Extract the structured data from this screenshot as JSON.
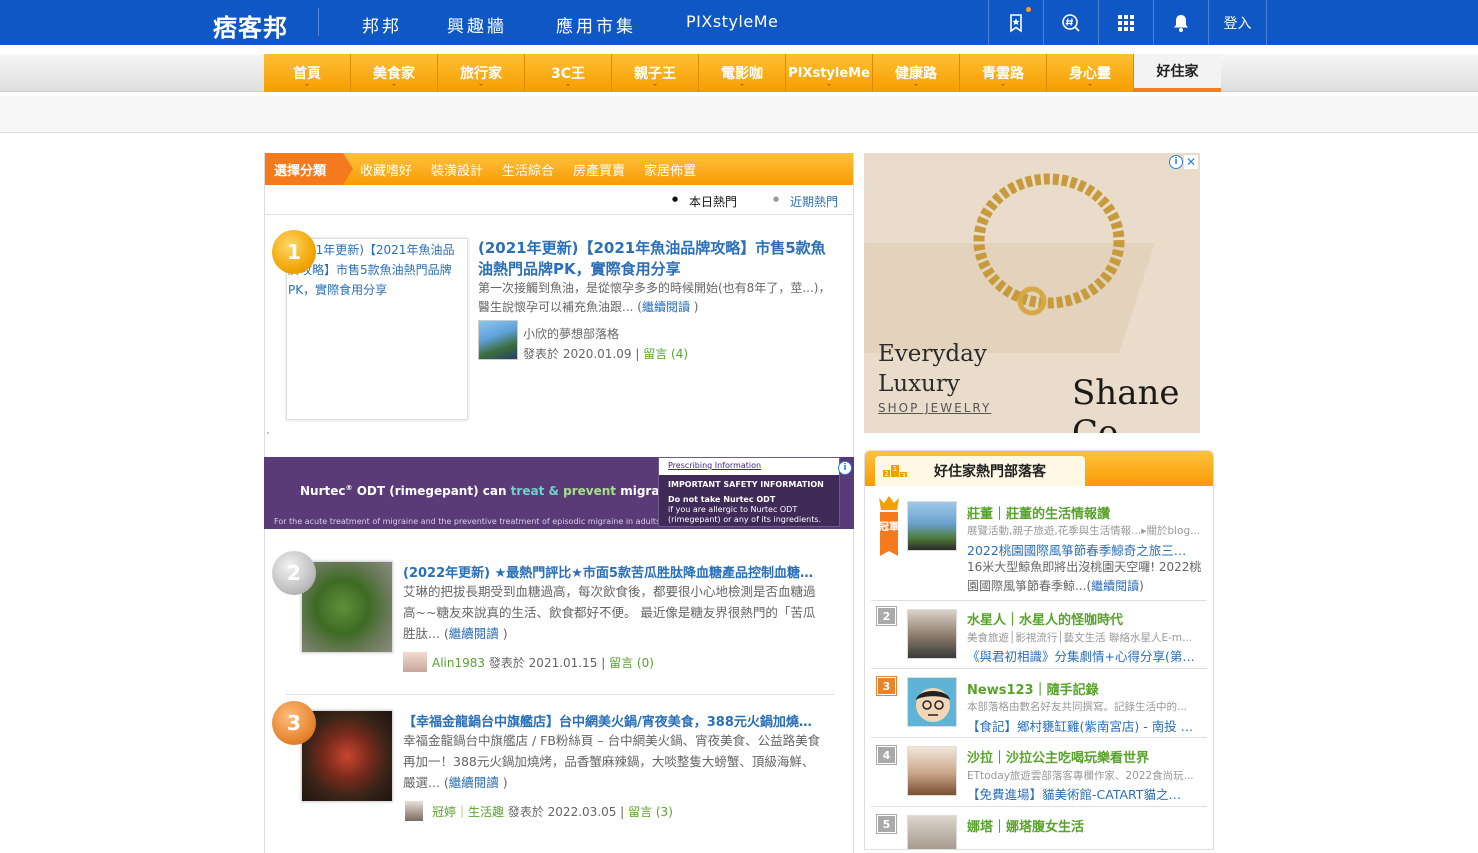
{
  "topbar": {
    "logo": "痞客邦",
    "nav": [
      "邦邦",
      "興趣牆",
      "應用市集",
      "PIXstyleMe"
    ],
    "login": "登入",
    "icons": [
      "bookmark-star-icon",
      "hashtag-search-icon",
      "grid-apps-icon",
      "bell-icon"
    ]
  },
  "channels": [
    "首頁",
    "美食家",
    "旅行家",
    "3C王",
    "親子王",
    "電影咖",
    "PIXstyleMe",
    "健康路",
    "青雲路",
    "身心靈",
    "好住家"
  ],
  "active_channel": "好住家",
  "category": {
    "selector": "選擇分類",
    "items": [
      "收藏嗜好",
      "裝潢設計",
      "生活綜合",
      "房產買賣",
      "家居佈置"
    ]
  },
  "hot_switch": {
    "today": "本日熱門",
    "recent": "近期熱門"
  },
  "articles": [
    {
      "rank": "1",
      "image_alt": "(2021年更新)【2021年魚油品牌攻略】市售5款魚油熱門品牌PK，實際食用分享",
      "title": "(2021年更新)【2021年魚油品牌攻略】市售5款魚油熱門品牌PK，實際食用分享",
      "desc": "第一次接觸到魚油，是從懷孕多多的時候開始(也有8年了，莖...)，醫生說懷孕可以補充魚油跟...",
      "more": "繼續閱讀",
      "blog": "小欣的夢想部落格",
      "posted": "發表於 2020.01.09 |",
      "comments": "留言 (4)"
    },
    {
      "rank": "2",
      "title": "(2022年更新) ★最熱門評比★市面5款苦瓜胜肽降血糖產品控制血糖的…",
      "desc": "艾琳的把拔長期受到血糖過高，每次飲食後，都要很小心地檢測是否血糖過高~~糖友來說真的生活、飲食都好不便。 最近像是糖友界很熱門的「苦瓜胜肽...",
      "more": "繼續閱讀",
      "blog": "Alin1983",
      "posted": "發表於 2021.01.15 |",
      "comments": "留言 (0)"
    },
    {
      "rank": "3",
      "title": "【幸福金龍鍋台中旗艦店】台中網美火鍋/宵夜美食，388元火鍋加燒烤…",
      "desc": "幸福金龍鍋台中旗艦店 / FB粉絲頁 – 台中網美火鍋、宵夜美食、公益路美食再加一！388元火鍋加燒烤，品香蟹麻辣鍋，大啖整隻大螃蟹、頂級海鮮、嚴選...",
      "more": "繼續閱讀",
      "blog": "冠婷｜生活趣",
      "posted": "發表於 2022.03.05 |",
      "comments": "留言 (3)"
    }
  ],
  "tick": "`",
  "ad_nurtec": {
    "brand": "Nurtec",
    "reg": "®",
    "generic": "ODT (rimegepant) can",
    "treat": "treat &",
    "prevent": "prevent",
    "tail": "migraines",
    "footnote": "For the acute treatment of migraine and the preventive treatment of episodic migraine in adults.",
    "pi_link": "Prescribing Information",
    "isi_title": "IMPORTANT SAFETY INFORMATION",
    "isi_bold": "Do not take Nurtec ODT",
    "isi_text": "if you are allergic to Nurtec ODT (rimegepant) or any of its ingredients."
  },
  "ad_shane": {
    "slogan_1": "Everyday",
    "slogan_2": "Luxury",
    "cta": "SHOP JEWELRY",
    "logo": "Shane Co."
  },
  "hot_blogs": {
    "title": "好住家熱門部落客",
    "crown_text": "冠軍",
    "items": [
      {
        "rank": "1",
        "name": "莊董｜莊董的生活情報讚",
        "tags": "展覽活動,親子旅遊,花季與生活情報...▸關於blog...",
        "post": "2022桃園國際風箏節春季鯨奇之旅三…",
        "desc": "16米大型鯨魚即將出沒桃園天空囉! 2022桃園國際風箏節春季鯨...",
        "more": "繼續閱讀"
      },
      {
        "rank": "2",
        "name": "水星人｜水星人的怪咖時代",
        "tags": "美食旅遊│影視流行│藝文生活 聯絡水星人E-m...",
        "post": "《與君初相識》分集劇情+心得分享(第…"
      },
      {
        "rank": "3",
        "name": "News123｜隨手記錄",
        "tags": "本部落格由數名好友共同撰寫。記錄生活中的...",
        "post": "【食記】鄉村甕缸雞(紫南宮店) - 南投 …"
      },
      {
        "rank": "4",
        "name": "沙拉｜沙拉公主吃喝玩樂看世界",
        "tags": "ETtoday旅遊雲部落客專欄作家、2022食尚玩...",
        "post": "【免費進場】貓美術館-CATART貓之…"
      },
      {
        "rank": "5",
        "name": "娜塔｜娜塔腹女生活"
      }
    ]
  },
  "colors": {
    "brand_blue": "#0f57c4",
    "orange": "#f89b06",
    "link": "#2a6fb8",
    "green": "#58a32c"
  }
}
